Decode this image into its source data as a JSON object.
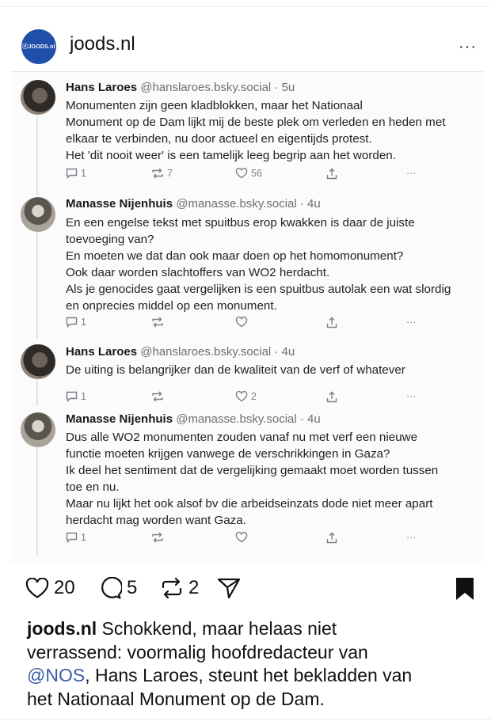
{
  "header": {
    "avatar_text": "ⓧJOODS.nl",
    "account": "joods.nl",
    "more": "···"
  },
  "thread": [
    {
      "name": "Hans Laroes",
      "handle": "@hanslaroes.bsky.social · 5u",
      "lines": [
        "Monumenten zijn geen kladblokken, maar het Nationaal",
        "Monument op de Dam lijkt mij de beste plek om verleden en heden met",
        "elkaar te verbinden, nu door actueel en eigentijds protest.",
        "Het 'dit nooit weer' is een tamelijk leeg begrip aan het worden."
      ],
      "replies": "1",
      "reposts": "7",
      "likes": "56",
      "more": "···"
    },
    {
      "name": "Manasse Nijenhuis",
      "handle": "@manasse.bsky.social · 4u",
      "lines": [
        "En een engelse tekst met spuitbus erop kwakken is daar de juiste",
        "toevoeging van?",
        "En moeten we dat dan ook maar doen op het homomonument?",
        "Ook daar worden slachtoffers van WO2 herdacht.",
        "Als je genocides gaat vergelijken is een spuitbus autolak een wat slordig",
        "en onprecies middel op een monument."
      ],
      "replies": "1",
      "reposts": "",
      "likes": "",
      "more": "···"
    },
    {
      "name": "Hans Laroes",
      "handle": "@hanslaroes.bsky.social · 4u",
      "lines": [
        "De uiting is belangrijker dan de kwaliteit van de verf of whatever"
      ],
      "replies": "1",
      "reposts": "",
      "likes": "2",
      "more": "···"
    },
    {
      "name": "Manasse Nijenhuis",
      "handle": "@manasse.bsky.social · 4u",
      "lines": [
        "Dus alle WO2 monumenten zouden vanaf nu met verf een nieuwe",
        "functie moeten krijgen vanwege de verschrikkingen in Gaza?",
        "Ik deel het sentiment dat de vergelijking gemaakt moet worden tussen",
        "toe en nu.",
        "Maar nu lijkt het ook alsof bv die arbeidseinzats dode niet meer apart",
        "herdacht mag worden want Gaza."
      ],
      "replies": "1",
      "reposts": "",
      "likes": "",
      "more": "···"
    }
  ],
  "engagement": {
    "likes": "20",
    "comments": "5",
    "reposts": "2"
  },
  "caption": {
    "account": "joods.nl",
    "line1_rest": " Schokkend, maar helaas niet",
    "line2": "verrassend: voormalig hoofdredacteur van",
    "mention": "@NOS",
    "line3_rest": ", Hans Laroes, steunt het bekladden van",
    "line4": "het Nationaal Monument op de Dam."
  }
}
